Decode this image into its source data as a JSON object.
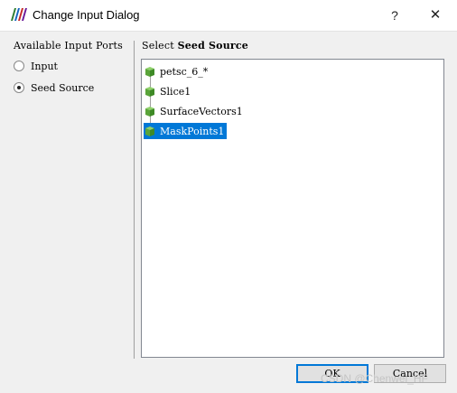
{
  "window": {
    "title": "Change Input Dialog",
    "help_label": "?",
    "close_label": "✕"
  },
  "ports": {
    "heading": "Available Input Ports",
    "options": [
      {
        "label": "Input",
        "checked": false
      },
      {
        "label": "Seed Source",
        "checked": true
      }
    ]
  },
  "select": {
    "heading_prefix": "Select ",
    "heading_bold": "Seed Source"
  },
  "tree": {
    "items": [
      {
        "label": "petsc_6_*",
        "selected": false
      },
      {
        "label": "Slice1",
        "selected": false
      },
      {
        "label": "SurfaceVectors1",
        "selected": false
      },
      {
        "label": "MaskPoints1",
        "selected": true
      }
    ]
  },
  "buttons": {
    "ok_label": "OK",
    "cancel_label": "Cancel"
  },
  "watermark": "CSDN @Chenwei_HF",
  "colors": {
    "selection": "#0078d7",
    "cube_green": "#6ab04c"
  }
}
